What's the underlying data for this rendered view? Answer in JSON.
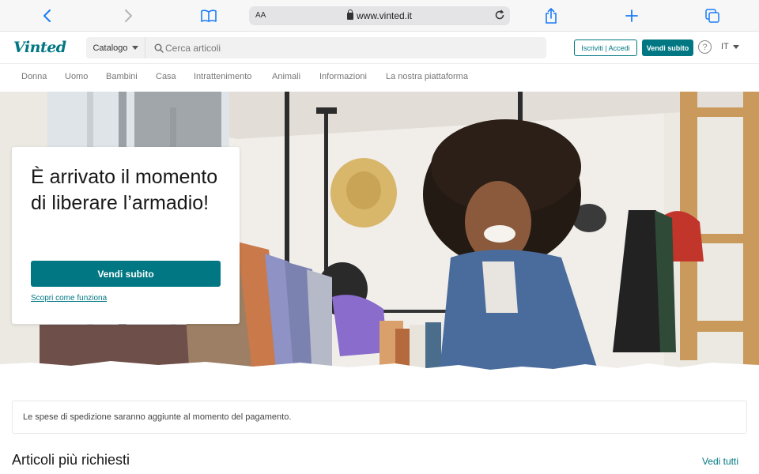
{
  "browser": {
    "text_size_label": "AA",
    "url": "www.vinted.it"
  },
  "header": {
    "logo": "Vinted",
    "catalog_label": "Catalogo",
    "search_placeholder": "Cerca articoli",
    "login_label": "Iscriviti | Accedi",
    "sell_label": "Vendi subito",
    "help_label": "?",
    "language": "IT"
  },
  "categories": [
    "Donna",
    "Uomo",
    "Bambini",
    "Casa",
    "Intrattenimento",
    "Animali",
    "Informazioni",
    "La nostra piattaforma"
  ],
  "hero": {
    "title": "È arrivato il momento di liberare l’armadio!",
    "cta_label": "Vendi subito",
    "link_label": "Scopri come funziona"
  },
  "info_banner": "Le spese di spedizione saranno aggiunte al momento del pagamento.",
  "section": {
    "title": "Articoli più richiesti",
    "see_all": "Vedi tutti"
  },
  "colors": {
    "brand": "#007782"
  }
}
